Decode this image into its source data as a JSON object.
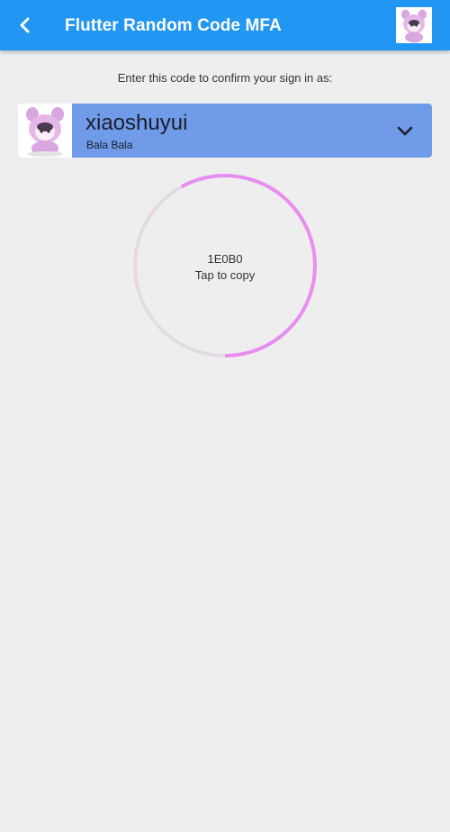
{
  "app_bar": {
    "title": "Flutter Random Code MFA",
    "back_icon": "chevron-left-icon",
    "avatar_icon": "kuromi-avatar-icon",
    "background_color": "#2196f3"
  },
  "instruction": "Enter this code to confirm your sign in as:",
  "account": {
    "name": "xiaoshuyui",
    "subtitle": "Bala Bala",
    "avatar_icon": "kuromi-avatar-icon",
    "dropdown_icon": "chevron-down-icon",
    "card_color": "#6f9be9"
  },
  "code": {
    "value": "1E0B0",
    "hint": "Tap to copy",
    "progress_fraction": 0.58,
    "progress_color": "#e88ef0",
    "track_color": "#e2dce2"
  }
}
